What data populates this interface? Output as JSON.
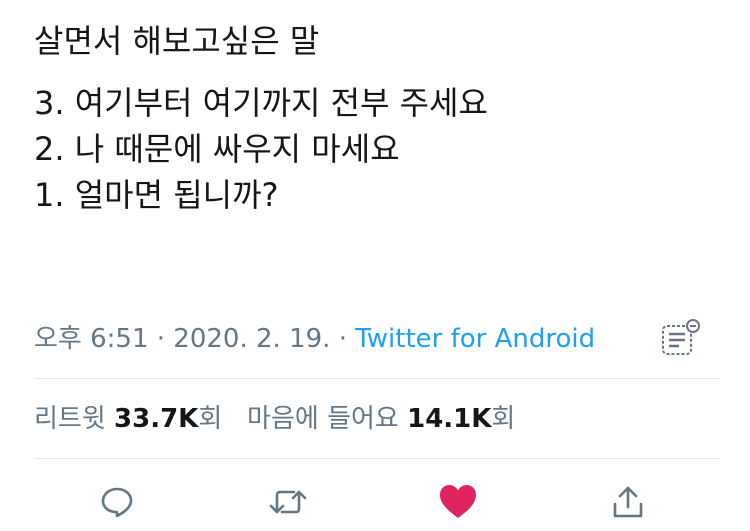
{
  "tweet": {
    "lines": [
      "살면서 해보고싶은 말",
      "3. 여기부터 여기까지 전부 주세요",
      "2. 나 때문에 싸우지 마세요",
      "1. 얼마면 됩니까?"
    ],
    "time": "오후 6:51",
    "date": "2020. 2. 19.",
    "separator": "·",
    "source": "Twitter for Android"
  },
  "stats": {
    "retweet_label": "리트윗",
    "retweet_count": "33.7K",
    "retweet_suffix": "회",
    "like_label": "마음에 들어요",
    "like_count": "14.1K",
    "like_suffix": "회"
  },
  "icons": {
    "reply": "reply-icon",
    "retweet": "retweet-icon",
    "like": "heart-icon",
    "share": "share-icon",
    "analytics": "analytics-icon"
  },
  "colors": {
    "text": "#14171a",
    "secondary": "#657786",
    "link": "#1da1f2",
    "like_active": "#e0245e",
    "divider": "#e1e8ed"
  }
}
